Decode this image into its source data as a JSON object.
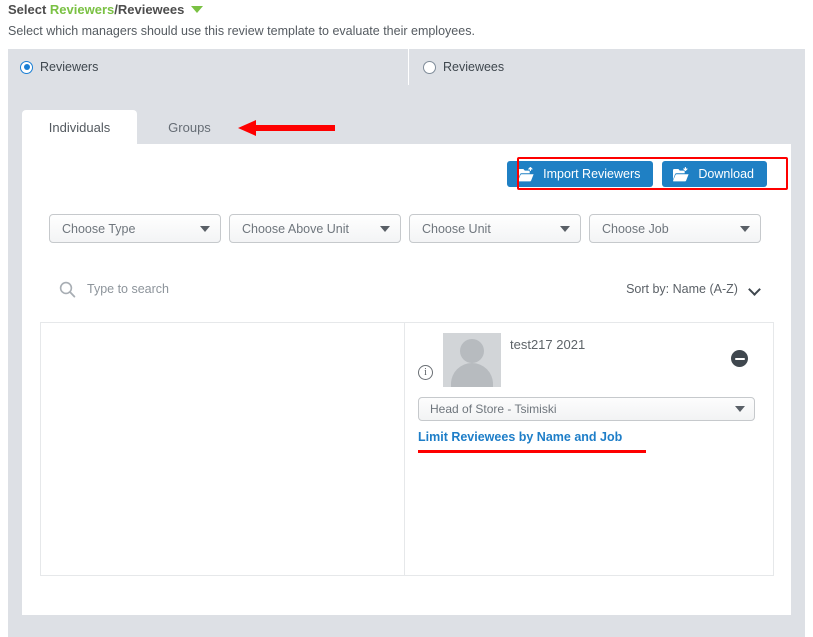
{
  "header": {
    "title_prefix": "Select ",
    "title_green": "Reviewers",
    "title_suffix": "/Reviewees",
    "caret_icon": "caret-down-icon",
    "subtitle": "Select which managers should use this review template to evaluate their employees."
  },
  "mode_selector": {
    "options": [
      {
        "label": "Reviewers",
        "selected": true
      },
      {
        "label": "Reviewees",
        "selected": false
      }
    ]
  },
  "tabs": [
    {
      "label": "Individuals",
      "active": true
    },
    {
      "label": "Groups",
      "active": false
    }
  ],
  "toolbar": {
    "import_label": "Import Reviewers",
    "import_icon": "folder-import-icon",
    "download_label": "Download",
    "download_icon": "folder-download-icon",
    "button_color": "#1f80c4"
  },
  "filters": [
    {
      "label": "Choose Type"
    },
    {
      "label": "Choose Above Unit"
    },
    {
      "label": "Choose Unit"
    },
    {
      "label": "Choose Job"
    }
  ],
  "search": {
    "placeholder": "Type to search",
    "value": "",
    "icon": "search-icon"
  },
  "sort": {
    "label": "Sort by: Name (A-Z)",
    "icon": "chevron-down-icon"
  },
  "selected_list": {
    "left_column_items": [],
    "right_column_items": [
      {
        "name": "test217 2021",
        "info_icon": "info-icon",
        "avatar_icon": "user-avatar-placeholder",
        "remove_icon": "remove-minus-icon",
        "job": "Head of Store - Tsimiski",
        "limit_link": "Limit Reviewees by Name and Job"
      }
    ]
  },
  "annotations": {
    "arrow_color": "#fe0000",
    "box_color": "#fe0000",
    "underline_color": "#fe0000"
  },
  "colors": {
    "accent_green": "#7ac143",
    "panel_gray": "#dde0e5",
    "link_blue": "#1e7ec8"
  }
}
